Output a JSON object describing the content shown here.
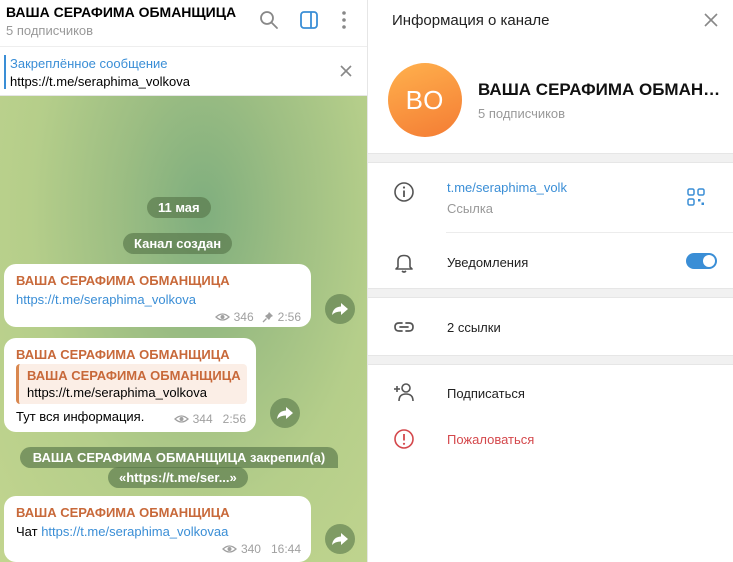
{
  "chat": {
    "title": "ВАША СЕРАФИМА ОБМАНЩИЦА",
    "subscribers": "5 подписчиков",
    "pinned": {
      "title": "Закреплённое сообщение",
      "text": "https://t.me/seraphima_volkova"
    },
    "date_label": "11 мая",
    "created_label": "Канал создан",
    "pinned_service_line1": "ВАША СЕРАФИМА ОБМАНЩИЦА закрепил(а)",
    "pinned_service_line2": "«https://t.me/ser...»",
    "messages": [
      {
        "author": "ВАША СЕРАФИМА ОБМАНЩИЦА",
        "link": "https://t.me/seraphima_volkova",
        "views": "346",
        "time": "2:56"
      },
      {
        "author": "ВАША СЕРАФИМА ОБМАНЩИЦА",
        "quote_author": "ВАША СЕРАФИМА ОБМАНЩИЦА",
        "quote_text": "https://t.me/seraphima_volkova",
        "text": "Тут вся информация.",
        "views": "344",
        "time": "2:56"
      },
      {
        "author": "ВАША СЕРАФИМА ОБМАНЩИЦА",
        "text_prefix": "Чат ",
        "link": "https://t.me/seraphima_volkovaa",
        "views": "340",
        "time": "16:44"
      }
    ]
  },
  "info": {
    "title": "Информация о канале",
    "avatar_initials": "ВО",
    "channel_name": "ВАША СЕРАФИМА ОБМАНЩИЦА",
    "subscribers": "5 подписчиков",
    "link_value": "t.me/seraphima_volk",
    "link_label": "Ссылка",
    "notifications_label": "Уведомления",
    "notifications_on": true,
    "links_count_label": "2 ссылки",
    "subscribe_label": "Подписаться",
    "report_label": "Пожаловаться"
  },
  "colors": {
    "accent": "#3a8ed6",
    "author": "#c8693a",
    "danger": "#d4484c",
    "avatar": "#f47c34"
  },
  "icons": [
    "search-icon",
    "sidebar-toggle-icon",
    "more-vertical-icon",
    "close-icon",
    "eye-icon",
    "pin-icon",
    "forward-icon",
    "info-icon",
    "qr-code-icon",
    "bell-icon",
    "link-icon",
    "add-user-icon",
    "report-icon"
  ]
}
